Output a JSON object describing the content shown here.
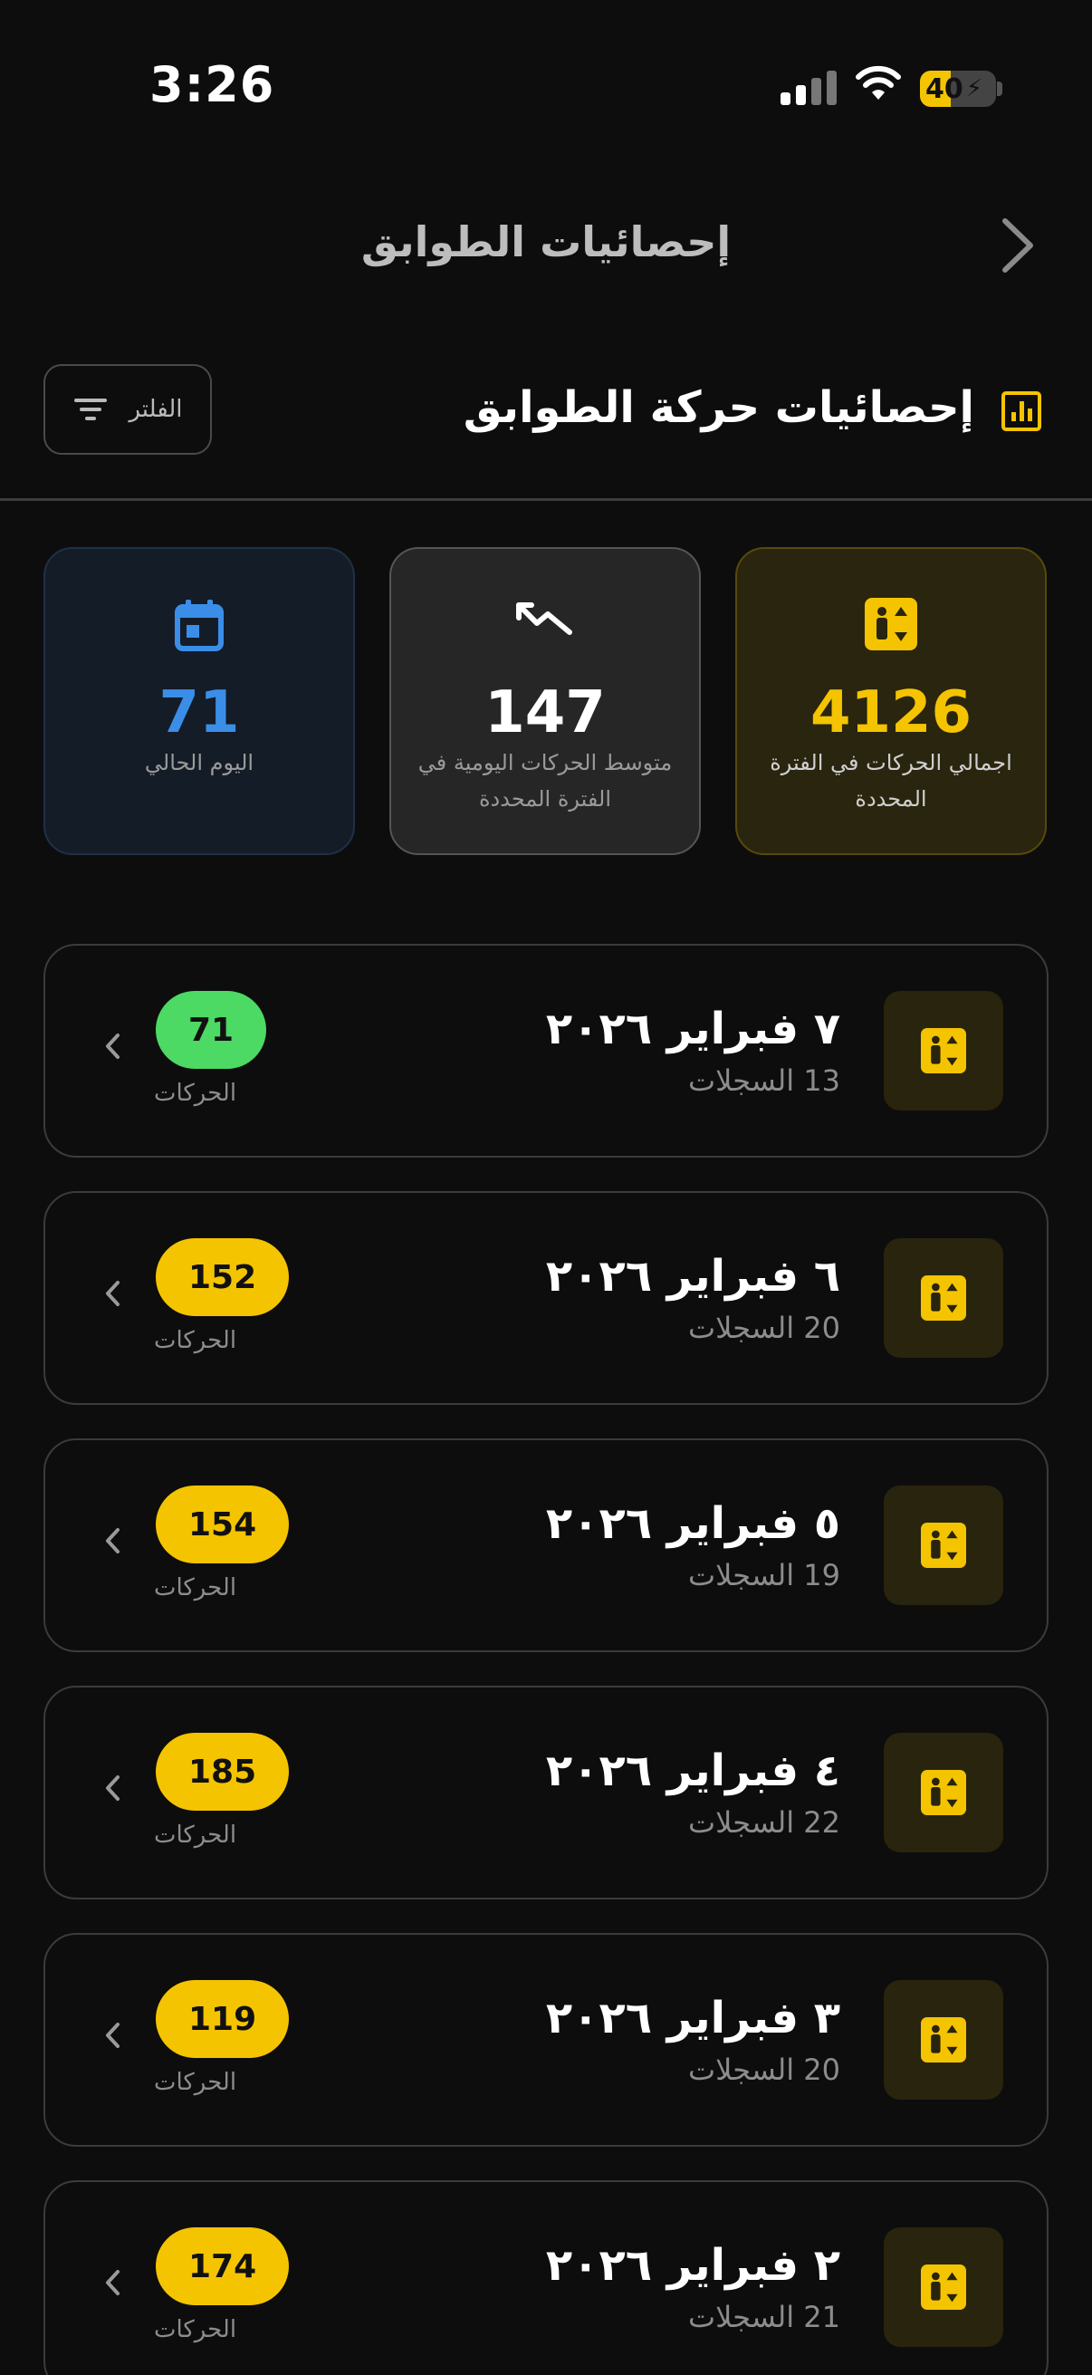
{
  "status_bar": {
    "time": "3:26",
    "battery": "40"
  },
  "nav": {
    "title": "إحصائيات الطوابق"
  },
  "header": {
    "title": "إحصائيات حركة الطوابق",
    "filter_label": "الفلتر"
  },
  "stats": [
    {
      "key": "today",
      "value": "71",
      "label": "اليوم الحالي",
      "icon": "calendar-icon",
      "color": "#3b8ee8"
    },
    {
      "key": "avg",
      "value": "147",
      "label": "متوسط الحركات اليومية في الفترة المحددة",
      "icon": "trending-icon",
      "color": "#ffffff"
    },
    {
      "key": "total",
      "value": "4126",
      "label": "اجمالي الحركات في الفترة المحددة",
      "icon": "elevator-icon",
      "color": "#f5c400"
    }
  ],
  "days": [
    {
      "date": "٧ فبراير ٢٠٢٦",
      "records": "13 السجلات",
      "moves": "71",
      "moves_label": "الحركات",
      "highlight": "green"
    },
    {
      "date": "٦ فبراير ٢٠٢٦",
      "records": "20 السجلات",
      "moves": "152",
      "moves_label": "الحركات",
      "highlight": "yellow"
    },
    {
      "date": "٥ فبراير ٢٠٢٦",
      "records": "19 السجلات",
      "moves": "154",
      "moves_label": "الحركات",
      "highlight": "yellow"
    },
    {
      "date": "٤ فبراير ٢٠٢٦",
      "records": "22 السجلات",
      "moves": "185",
      "moves_label": "الحركات",
      "highlight": "yellow"
    },
    {
      "date": "٣ فبراير ٢٠٢٦",
      "records": "20 السجلات",
      "moves": "119",
      "moves_label": "الحركات",
      "highlight": "yellow"
    },
    {
      "date": "٢ فبراير ٢٠٢٦",
      "records": "21 السجلات",
      "moves": "174",
      "moves_label": "الحركات",
      "highlight": "yellow"
    }
  ],
  "colors": {
    "accent": "#f5c400",
    "today": "#3b8ee8",
    "success": "#4cd964"
  }
}
